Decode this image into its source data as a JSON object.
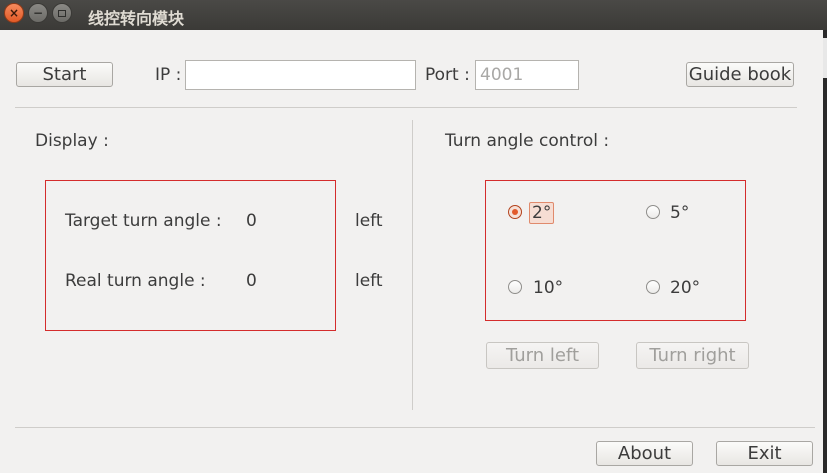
{
  "window": {
    "title": "线控转向模块",
    "controls": {
      "close": "×",
      "minimize": "−"
    }
  },
  "toolbar": {
    "start_label": "Start",
    "ip_label": "IP :",
    "ip_value": "",
    "port_label": "Port :",
    "port_placeholder": "4001",
    "guide_label": "Guide book"
  },
  "display": {
    "title": "Display :",
    "target_label": "Target turn angle :",
    "target_value": "0",
    "target_direction": "left",
    "real_label": "Real turn angle :",
    "real_value": "0",
    "real_direction": "left"
  },
  "control": {
    "title": "Turn angle control :",
    "options": [
      {
        "label": "2°",
        "checked": true
      },
      {
        "label": "5°",
        "checked": false
      },
      {
        "label": "10°",
        "checked": false
      },
      {
        "label": "20°",
        "checked": false
      }
    ],
    "turn_left_label": "Turn left",
    "turn_right_label": "Turn right"
  },
  "footer": {
    "about_label": "About",
    "exit_label": "Exit"
  },
  "colors": {
    "titlebar": "#3c3b37",
    "highlight_box": "#d42c2c",
    "radio_accent": "#e2592a",
    "background": "#f2f1f0"
  }
}
